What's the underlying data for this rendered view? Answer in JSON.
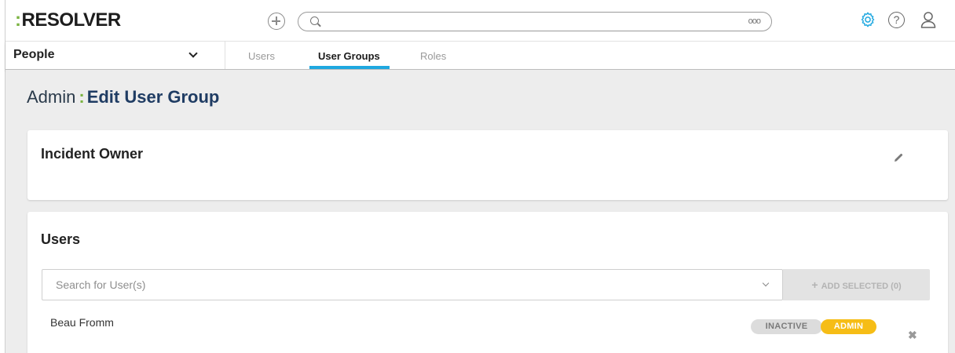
{
  "app": {
    "logo_colon": ":",
    "logo_text": "RESOLVER"
  },
  "header": {
    "search_more": "ooo",
    "icons": {
      "add": "plus-circle-icon",
      "search": "search-icon",
      "settings": "gear-icon",
      "help": "help-icon",
      "user": "user-icon"
    },
    "help_glyph": "?"
  },
  "nav": {
    "section": "People",
    "tabs": [
      {
        "label": "Users",
        "active": false
      },
      {
        "label": "User Groups",
        "active": true
      },
      {
        "label": "Roles",
        "active": false
      }
    ]
  },
  "page": {
    "prefix": "Admin",
    "separator": ":",
    "title": "Edit User Group"
  },
  "group": {
    "name": "Incident Owner"
  },
  "users_section": {
    "title": "Users",
    "search_placeholder": "Search for User(s)",
    "add_selected_label": "ADD SELECTED (0)",
    "add_selected_plus": "+",
    "members": [
      {
        "name": "Beau Fromm",
        "status_badge": "INACTIVE",
        "role_badge": "ADMIN",
        "remove_glyph": "✖"
      }
    ]
  },
  "colors": {
    "accent_green": "#7bb342",
    "tab_underline": "#1fa8e0",
    "settings_icon": "#1fa8e0",
    "admin_badge": "#f6bd16",
    "title_blue": "#1f3c63"
  }
}
